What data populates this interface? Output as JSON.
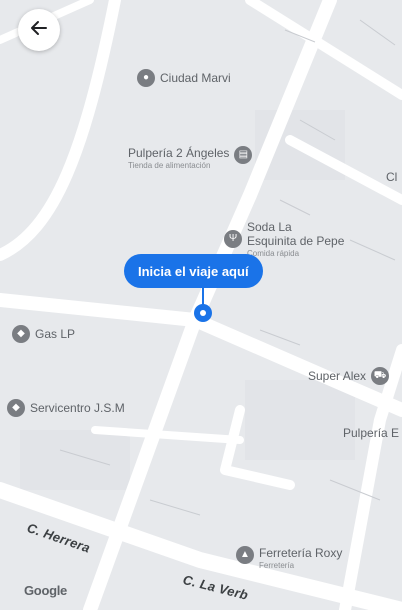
{
  "back_button": {
    "icon": "arrow-left-icon"
  },
  "pin": {
    "label": "Inicia el viaje aquí"
  },
  "pois": {
    "ciudad_marvi": {
      "name": "Ciudad Marvi",
      "icon": "shopping-icon"
    },
    "pulperia_2_angeles": {
      "name": "Pulpería 2 Ángeles",
      "subtitle": "Tienda de alimentación",
      "icon": "grocery-icon"
    },
    "soda_la_esquinita": {
      "name_line1": "Soda La",
      "name_line2": "Esquinita de Pepe",
      "subtitle": "Comida rápida",
      "icon": "restaurant-icon"
    },
    "gas_lp": {
      "name": "Gas LP",
      "icon": "store-icon"
    },
    "super_alex": {
      "name": "Super Alex",
      "icon": "cart-icon"
    },
    "servicentro": {
      "name": "Servicentro J.S.M",
      "icon": "store-icon"
    },
    "pulperia_e": {
      "name": "Pulpería E"
    },
    "ferreteria_roxy": {
      "name": "Ferretería Roxy",
      "subtitle": "Ferretería",
      "icon": "hardware-icon"
    },
    "edge_label": {
      "name": "Cl"
    }
  },
  "streets": {
    "herrera": "C. Herrera",
    "la_verbena": "C. La Verb"
  },
  "attribution": {
    "text": "Google"
  },
  "colors": {
    "accent": "#1a73e8",
    "road": "#ffffff",
    "map_background": "#e7e9ec",
    "poi_icon": "#7a7d82"
  }
}
